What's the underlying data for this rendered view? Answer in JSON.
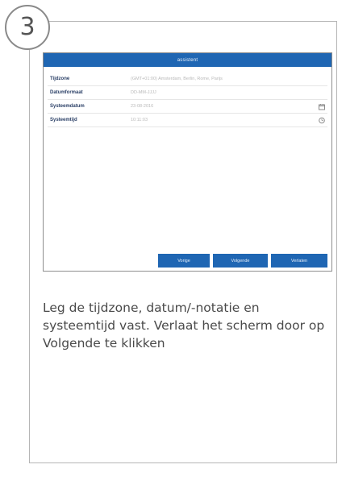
{
  "step": {
    "number": "3"
  },
  "screen": {
    "title": "assistent",
    "settings": [
      {
        "label": "Tijdzone",
        "value": "(GMT+01:00) Amsterdam, Berlin, Rome, Parijs",
        "icon": ""
      },
      {
        "label": "Datumformaat",
        "value": "DD-MM-JJJJ",
        "icon": ""
      },
      {
        "label": "Systeemdatum",
        "value": "23-08-2016",
        "icon": "calendar-icon"
      },
      {
        "label": "Systeemtijd",
        "value": "10:11:03",
        "icon": "clock-icon"
      }
    ],
    "buttons": {
      "previous": "Vorige",
      "next": "Volgende",
      "exit": "Verlaten"
    }
  },
  "caption": "Leg de tijdzone, datum/-notatie en systeemtijd vast. Verlaat het scherm door op Volgende te klikken",
  "colors": {
    "accent": "#1f66b3",
    "label": "#2a3f66",
    "value": "#b9b9b9",
    "caption": "#4a4a4a"
  }
}
